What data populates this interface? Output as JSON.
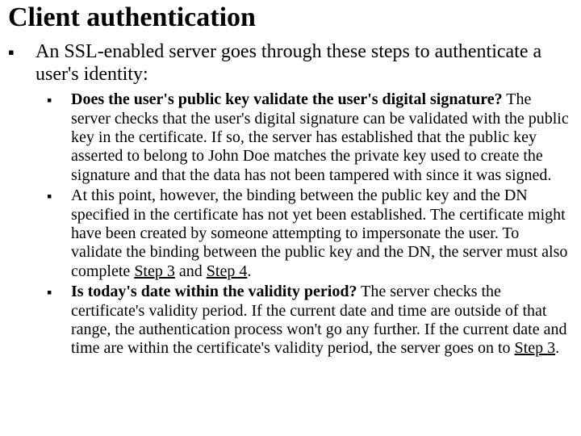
{
  "title": "Client authentication",
  "intro": "An SSL-enabled server goes through these steps to authenticate a user's identity:",
  "sub": [
    {
      "bold": "Does the user's public key validate the user's digital signature?",
      "rest": " The server checks that the user's digital signature can be validated with the public key in the certificate. If so, the server has established that the public key asserted to belong to John Doe matches the private key used to create the signature and that the data has not been tampered with since it was signed."
    },
    {
      "pre": "At this point, however, the binding between the public key and the DN specified in the certificate has not yet been established. The certificate might have been created by someone attempting to impersonate the user. To validate the binding between the public key and the DN, the server must also complete ",
      "link1": "Step 3",
      "mid": " and ",
      "link2": "Step 4",
      "post": "."
    },
    {
      "bold": "Is today's date within the validity period?",
      "pre": " The server checks the certificate's validity period. If the current date and time are outside of that range, the authentication process won't go any further. If the current date and time are within the certificate's validity period, the server goes on to ",
      "link1": "Step 3",
      "post": "."
    }
  ]
}
